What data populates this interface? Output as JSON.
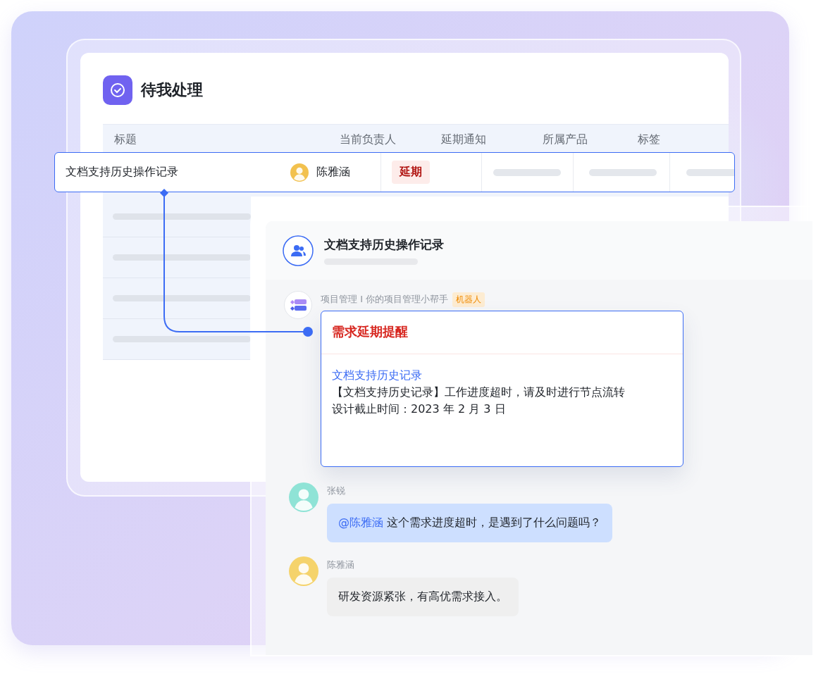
{
  "todo_panel": {
    "title": "待我处理",
    "columns": [
      "标题",
      "当前负责人",
      "延期通知",
      "所属产品",
      "标签"
    ],
    "highlighted_row": {
      "title": "文档支持历史操作记录",
      "owner": "陈雅涵",
      "delay_tag": "延期"
    }
  },
  "chat_panel": {
    "title": "文档支持历史操作记录",
    "messages": [
      {
        "kind": "bot",
        "sender": "项目管理 I 你的项目管理小帮手",
        "badge": "机器人",
        "card": {
          "title": "需求延期提醒",
          "link": "文档支持历史记录",
          "lines": [
            "【文档支持历史记录】工作进度超时，请及时进行节点流转",
            "设计截止时间：2023 年 2 月 3 日"
          ]
        }
      },
      {
        "kind": "mention",
        "sender": "张锐",
        "mention": "@陈雅涵",
        "text": "这个需求进度超时，是遇到了什么问题吗？"
      },
      {
        "kind": "plain",
        "sender": "陈雅涵",
        "text": "研发资源紧张，有高优需求接入。"
      }
    ]
  }
}
